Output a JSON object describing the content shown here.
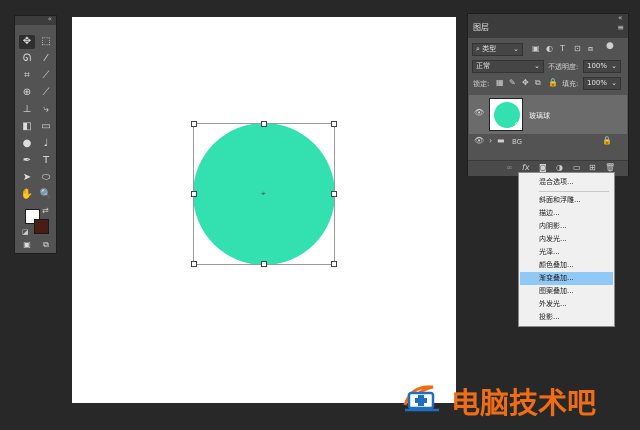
{
  "colors": {
    "workspace": "#282828",
    "circle": "#32e0b0",
    "foreground": "#ffffff",
    "background": "#4a1d14",
    "menu_highlight": "#90c8f6",
    "watermark": "#ef6d16"
  },
  "toolbar": {
    "tools": [
      "move-icon",
      "marquee-icon",
      "lasso-icon",
      "magic-wand-icon",
      "crop-icon",
      "eyedropper-icon",
      "healing-brush-icon",
      "brush-icon",
      "clone-stamp-icon",
      "history-brush-icon",
      "eraser-icon",
      "gradient-icon",
      "blur-icon",
      "dodge-icon",
      "pen-icon",
      "type-icon",
      "path-selection-icon",
      "ellipse-icon",
      "hand-icon",
      "zoom-icon",
      "more-tools-icon"
    ]
  },
  "layers_panel": {
    "title": "图层",
    "filter_kind": "类型",
    "blend_mode": "正常",
    "opacity_label": "不透明度:",
    "opacity_value": "100%",
    "lock_label": "锁定:",
    "fill_label": "填充:",
    "fill_value": "100%",
    "layers": [
      {
        "name": "玻璃球",
        "selected": true
      },
      {
        "name": "BG",
        "selected": false
      }
    ],
    "bottom_fx_label": "fx"
  },
  "context_menu": {
    "items": [
      "混合选项...",
      "斜面和浮雕...",
      "描边...",
      "内阴影...",
      "内发光...",
      "光泽...",
      "颜色叠加...",
      "渐变叠加...",
      "图案叠加...",
      "外发光...",
      "投影..."
    ],
    "highlighted_index": 7
  },
  "watermark": {
    "text": "电脑技术吧"
  }
}
